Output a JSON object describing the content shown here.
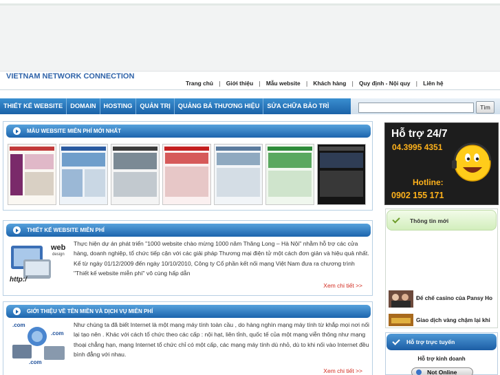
{
  "header": {
    "brand": "VIETNAM NETWORK CONNECTION"
  },
  "top_nav": [
    {
      "label": "Trang chủ"
    },
    {
      "label": "Giới thiệu"
    },
    {
      "label": "Mẫu website"
    },
    {
      "label": "Khách hàng"
    },
    {
      "label": "Quy định - Nội quy"
    },
    {
      "label": "Liên hệ"
    }
  ],
  "top_nav_separator": "|",
  "main_nav": [
    {
      "label": "THIẾT KẾ WEBSITE"
    },
    {
      "label": "DOMAIN"
    },
    {
      "label": "HOSTING"
    },
    {
      "label": "QUẢN TRỊ"
    },
    {
      "label": "QUẢNG BÁ THƯƠNG HIỆU"
    },
    {
      "label": "SỬA CHỮA BẢO TRÌ"
    }
  ],
  "search": {
    "value": "",
    "button": "Tìm"
  },
  "sections": {
    "templates": {
      "title": "MẪU WEBSITE MIỄN PHÍ MỚI NHẤT"
    },
    "free_design": {
      "title": "THIẾT KẾ WEBSITE MIỄN PHÍ",
      "text": "Thực hiện dự án phát triển \"1000 website chào mừng 1000 năm Thăng Long – Hà Nội\" nhằm hỗ trợ các cửa hàng, doanh nghiệp, tổ chức tiếp cận với các giải pháp Thương mại điện tử một cách đơn giản và hiệu quả nhất. Kể từ ngày 01/12/2009 đến ngày 10/10/2010, Công ty Cổ phần kết nối mạng Việt Nam đưa ra chương trình \"Thiết kế website miễn phí\" vô cùng hấp dẫn",
      "more": "Xem chi tiết >>",
      "illus_label_1": "web",
      "illus_label_2": "design",
      "illus_label_3": "http:/"
    },
    "domain_service": {
      "title": "GIỚI THIỆU VỀ TÊN MIỀN VÀ DỊCH VỤ MIỄN PHÍ",
      "text": "Như chúng ta đã biết Internet là một mạng máy tính toàn cầu , do hàng nghìn mạng máy tính từ khắp mọi nơi nối lại tạo nên . Khác với cách tổ chức theo các cấp : nội hạt, liên tỉnh, quốc tế của một mạng viễn thông như mạng thoại chẳng hạn, mạng Internet tổ chức chỉ có một cấp, các mạng máy tính dù nhỏ, dù to khi nối vào Internet đều bình đẳng với nhau.",
      "more": "Xem chi tiết >>",
      "illus_label_1": ".com",
      "illus_label_2": ".com",
      "illus_label_3": ".com"
    }
  },
  "support": {
    "title": "Hỗ trợ 24/7",
    "phone": "04.3995 4351",
    "hotline_label": "Hotline:",
    "hotline": "0902 155 171"
  },
  "news": {
    "title": "Thông tin mới",
    "items": [
      {
        "title": "Đế chế casino của Pansy Ho"
      },
      {
        "title": "Giao dịch vàng chậm lại khi"
      }
    ]
  },
  "online_support": {
    "title": "Hỗ trợ trực tuyến",
    "subtitle": "Hỗ trợ kinh doanh",
    "status": "Not Online"
  },
  "colors": {
    "brand_blue": "#2f63a9",
    "nav_blue": "#1b62a8",
    "link_red": "#d22a1e",
    "support_orange": "#ffb21b"
  }
}
